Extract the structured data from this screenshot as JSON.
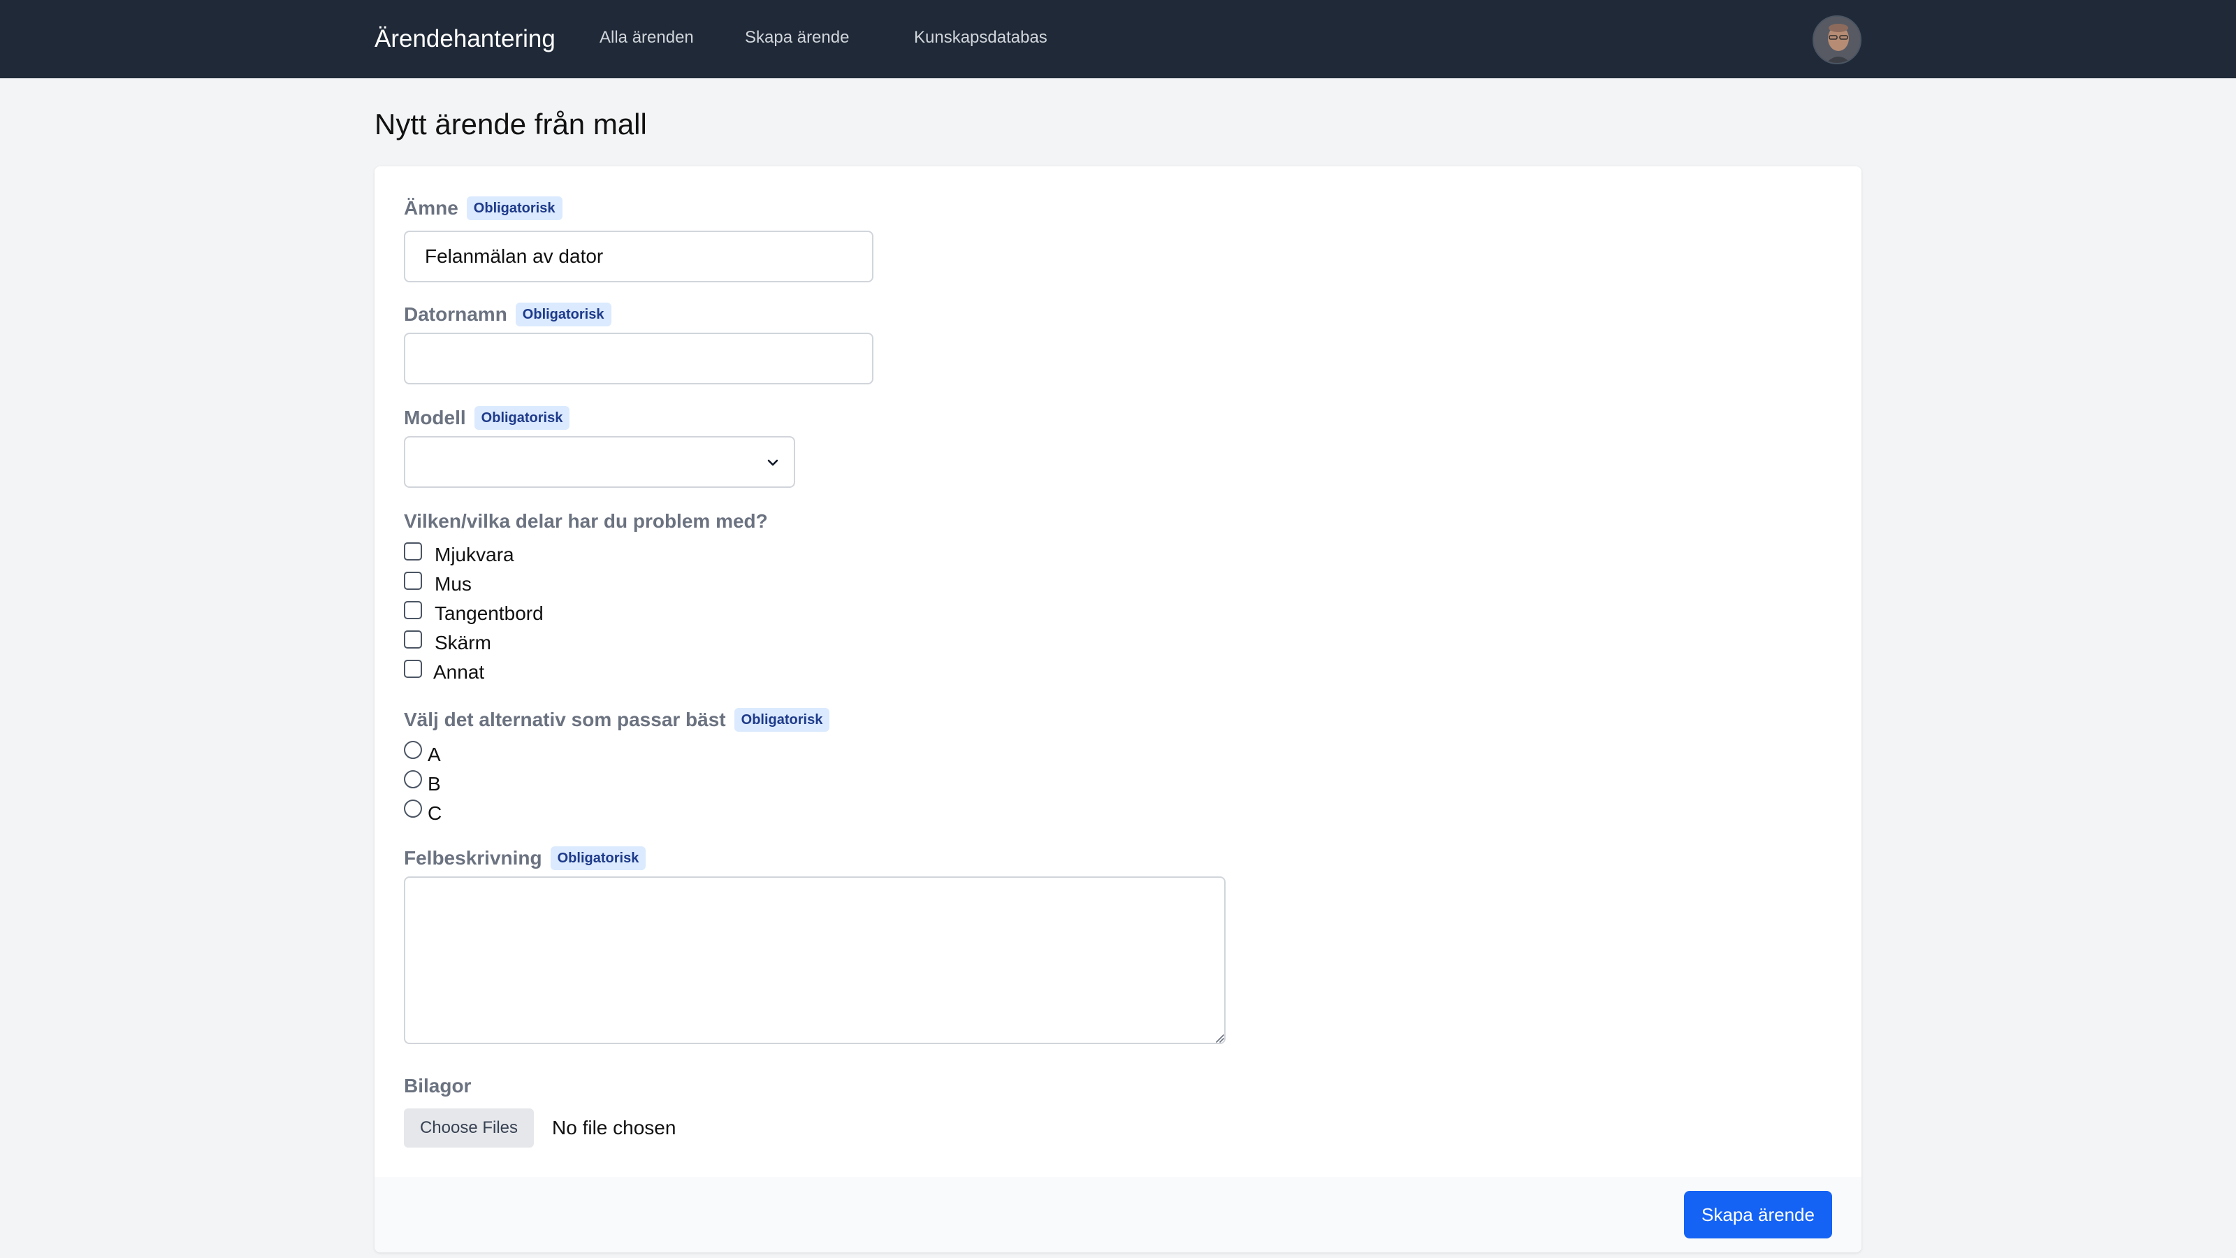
{
  "nav": {
    "brand": "Ärendehantering",
    "links": [
      {
        "label": "Alla ärenden"
      },
      {
        "label": "Skapa ärende"
      },
      {
        "label": "Kunskapsdatabas"
      }
    ]
  },
  "page": {
    "title": "Nytt ärende från mall"
  },
  "form": {
    "required_badge": "Obligatorisk",
    "subject": {
      "label": "Ämne",
      "value": "Felanmälan av dator"
    },
    "computer_name": {
      "label": "Datornamn",
      "value": ""
    },
    "model": {
      "label": "Modell",
      "selected": ""
    },
    "parts": {
      "label": "Vilken/vilka delar har du problem med?",
      "options": [
        "Mjukvara",
        "Mus",
        "Tangentbord",
        "Skärm",
        "Annat"
      ]
    },
    "best_option": {
      "label": "Välj det alternativ som passar bäst",
      "options": [
        "A",
        "B",
        "C"
      ]
    },
    "description": {
      "label": "Felbeskrivning",
      "value": ""
    },
    "attachments": {
      "label": "Bilagor",
      "button": "Choose Files",
      "status": "No file chosen"
    },
    "submit": "Skapa ärende"
  },
  "colors": {
    "topbar": "#1f2937",
    "primary": "#1463f5",
    "badge_bg": "#dbeafe",
    "badge_text": "#1e3a8a"
  }
}
